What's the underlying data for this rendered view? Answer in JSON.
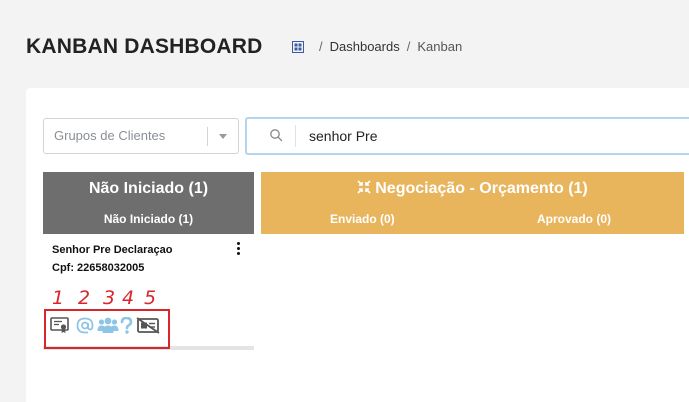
{
  "header": {
    "title": "KANBAN DASHBOARD",
    "breadcrumb": {
      "home_icon": "home-grid-icon",
      "items": [
        "Dashboards",
        "Kanban"
      ],
      "separator": "/"
    }
  },
  "filters": {
    "group_select": {
      "placeholder": "Grupos de Clientes"
    },
    "search": {
      "value": "senhor Pre",
      "icon": "search-icon"
    }
  },
  "columns": [
    {
      "title": "Não Iniciado (1)",
      "subs": [
        "Não Iniciado (1)"
      ],
      "color": "#6e6e6e"
    },
    {
      "title": "Negociação - Orçamento (1)",
      "icon": "shrink-arrows-icon",
      "subs": [
        "Enviado (0)",
        "Aprovado (0)"
      ],
      "color": "#e8b55d"
    }
  ],
  "lead": {
    "name": "Senhor Pre Declaraçao",
    "cpf": "Cpf: 22658032005",
    "icons": [
      "certificate-icon",
      "at-sign-icon",
      "users-icon",
      "question-icon",
      "id-card-off-icon"
    ]
  },
  "annotations": {
    "numbers": [
      "1",
      "2",
      "3",
      "4",
      "5"
    ],
    "color": "#d9262c"
  }
}
